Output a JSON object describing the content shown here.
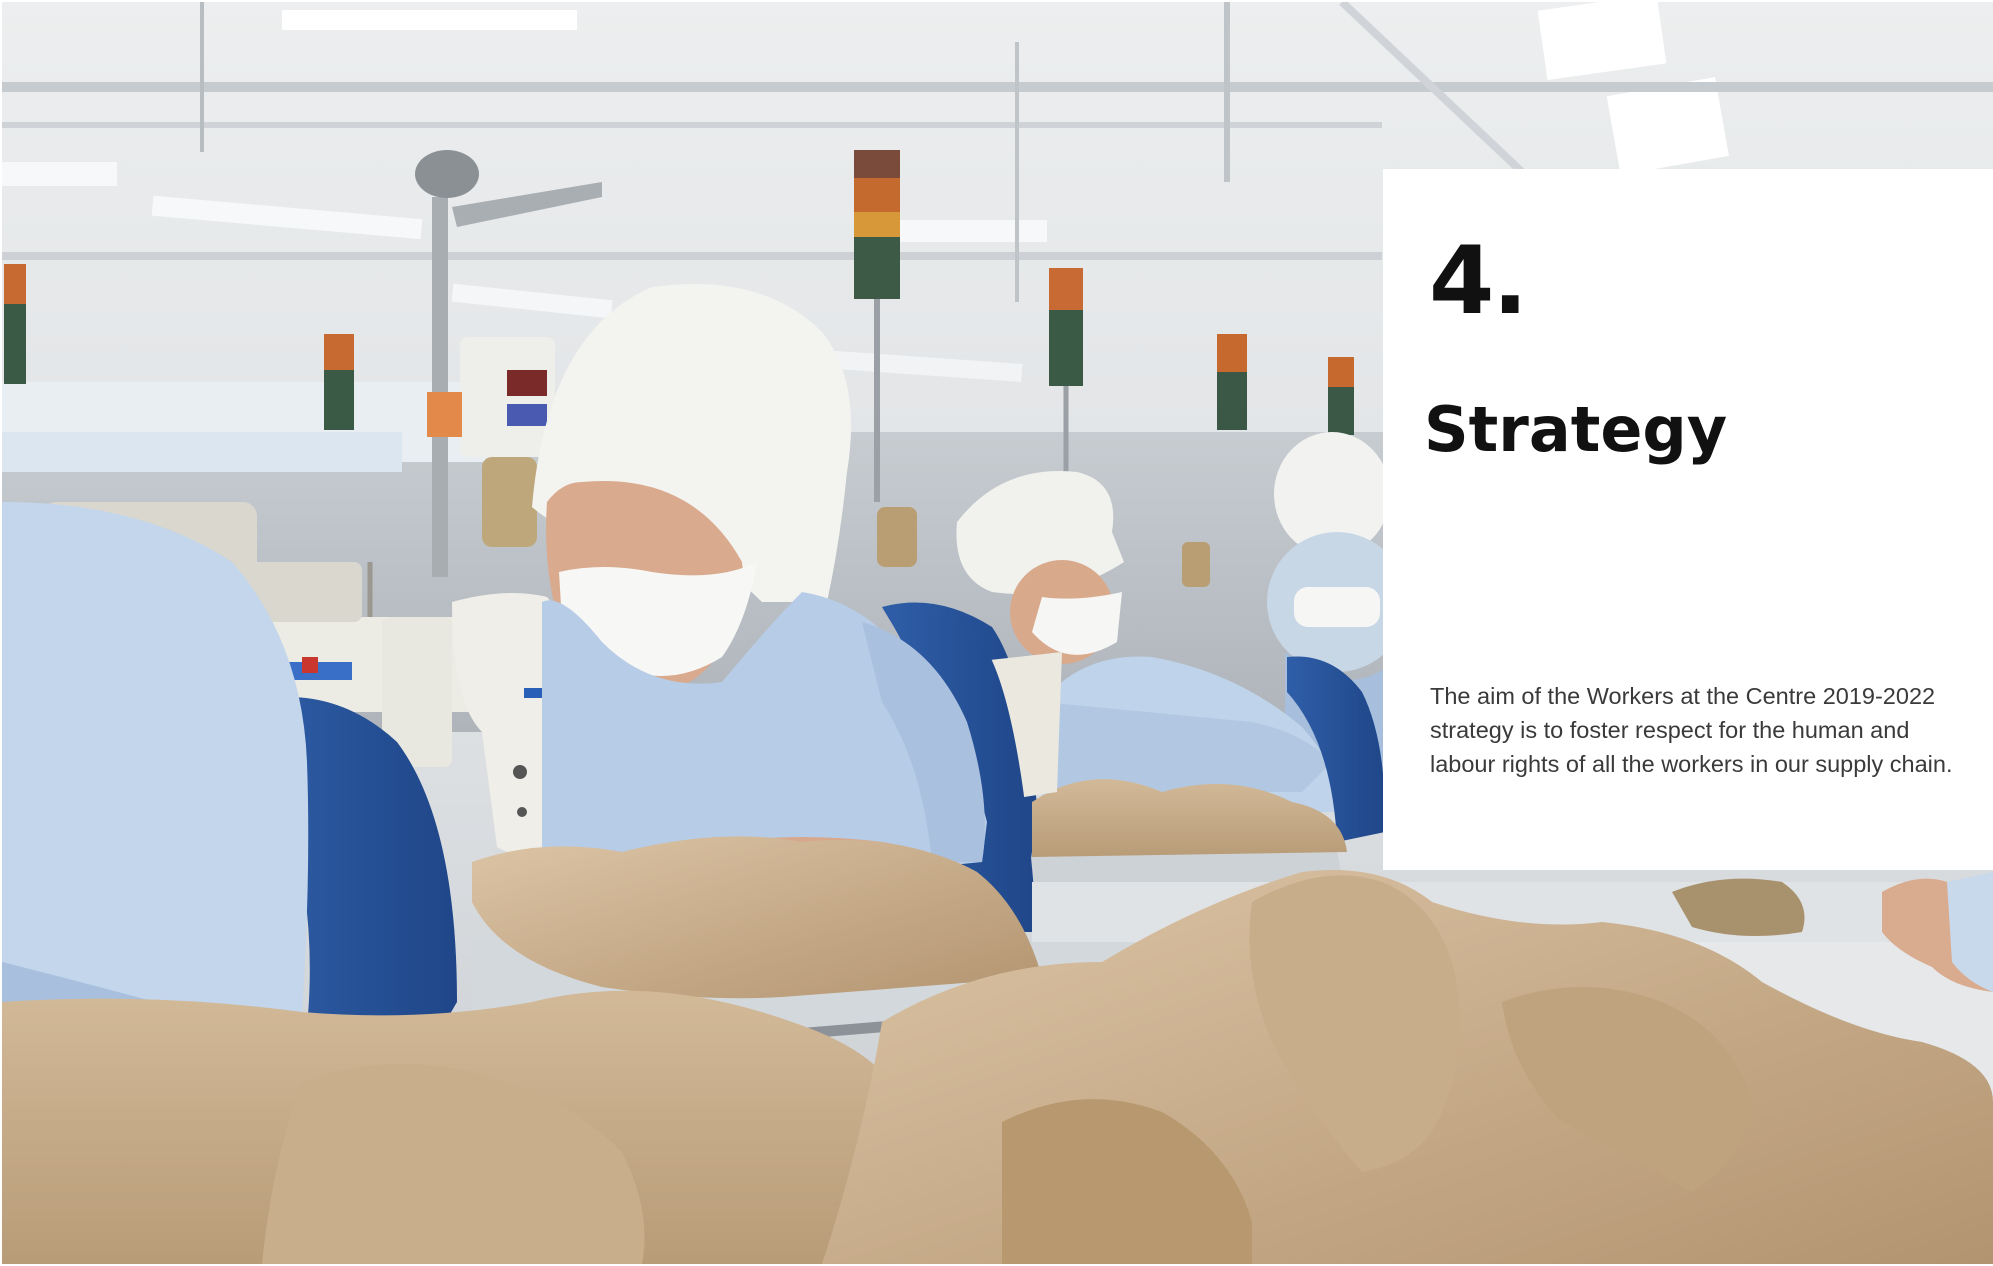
{
  "photo": {
    "description_icon": "factory-photo"
  },
  "chapter": {
    "number": "4.",
    "title": "Strategy",
    "intro": "The aim of the Workers at the Centre 2019-2022 strategy is to foster respect for the human and labour rights of all the workers in our supply chain."
  },
  "colors": {
    "panel_background": "#ffffff",
    "heading_text": "#111111",
    "body_text": "#3a3a3a"
  }
}
